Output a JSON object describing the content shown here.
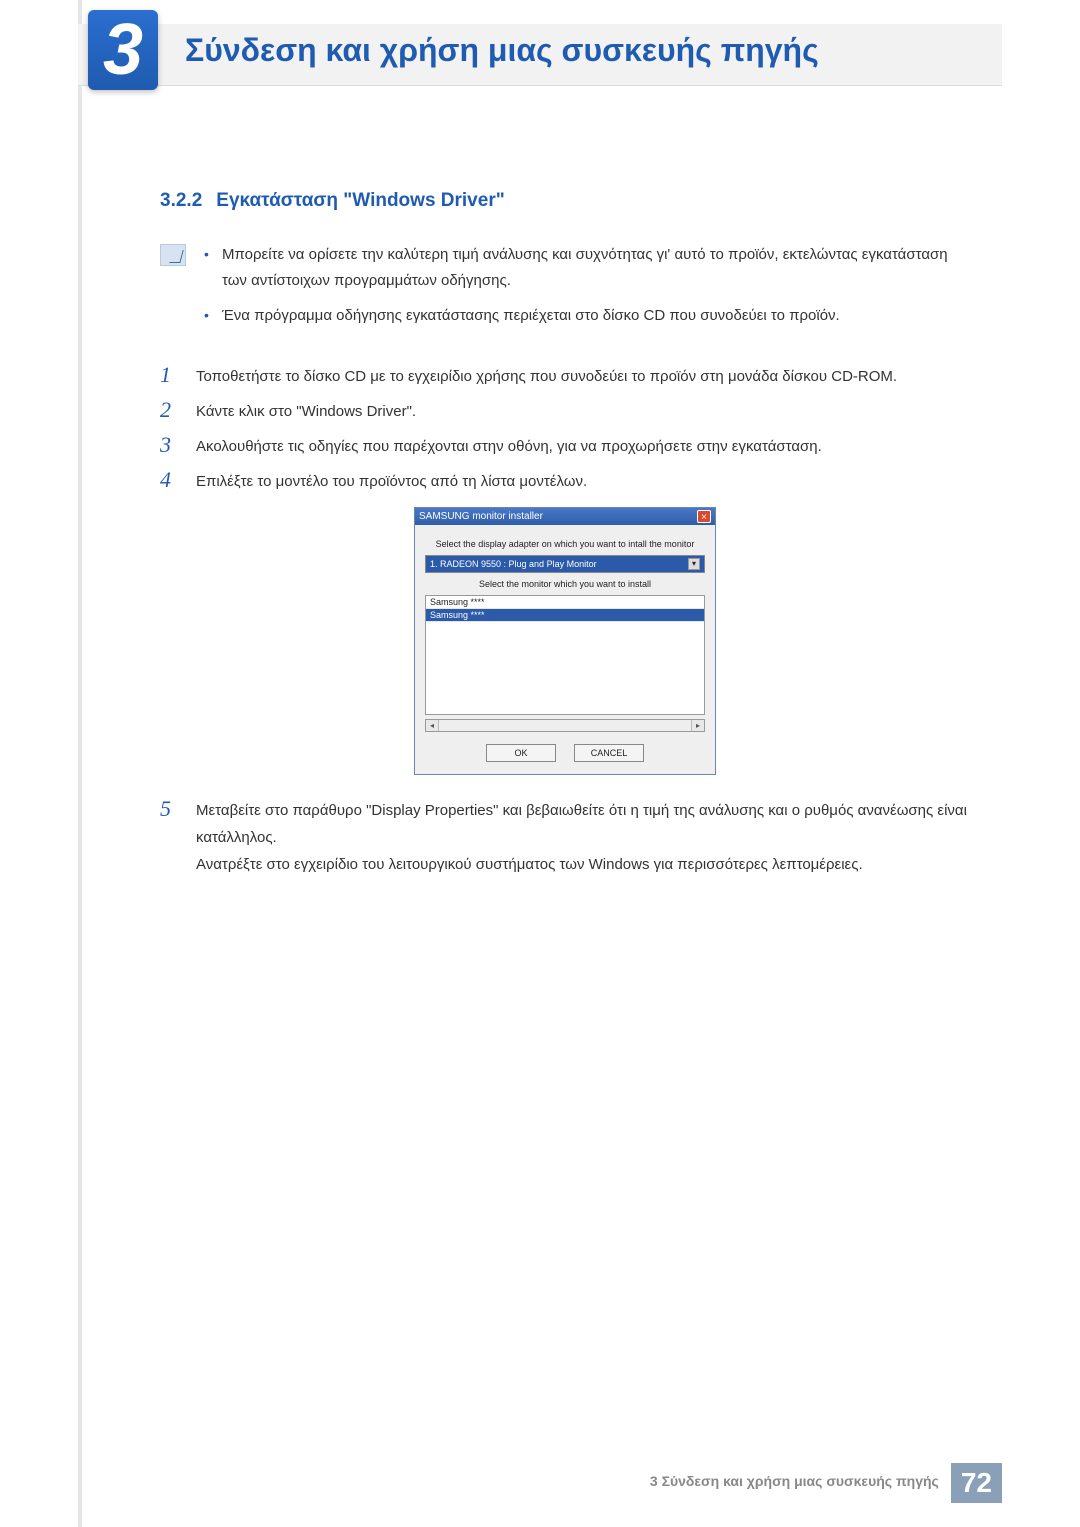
{
  "header": {
    "chapter_number": "3",
    "chapter_title": "Σύνδεση και χρήση μιας συσκευής πηγής"
  },
  "subsection": {
    "number": "3.2.2",
    "title": "Εγκατάσταση \"Windows Driver\""
  },
  "notes": [
    "Μπορείτε να ορίσετε την καλύτερη τιμή ανάλυσης και συχνότητας γι' αυτό το προϊόν, εκτελώντας εγκατάσταση των αντίστοιχων προγραμμάτων οδήγησης.",
    "Ένα πρόγραμμα οδήγησης εγκατάστασης περιέχεται στο δίσκο CD που συνοδεύει το προϊόν."
  ],
  "steps": [
    {
      "n": "1",
      "text": "Τοποθετήστε το δίσκο CD με το εγχειρίδιο χρήσης που συνοδεύει το προϊόν στη μονάδα δίσκου CD-ROM."
    },
    {
      "n": "2",
      "text": "Κάντε κλικ στο \"Windows Driver\"."
    },
    {
      "n": "3",
      "text": "Ακολουθήστε τις οδηγίες που παρέχονται στην οθόνη, για να προχωρήσετε στην εγκατάσταση."
    },
    {
      "n": "4",
      "text": "Επιλέξτε το μοντέλο του προϊόντος από τη λίστα μοντέλων."
    },
    {
      "n": "5",
      "text": "Μεταβείτε στο παράθυρο \"Display Properties\" και βεβαιωθείτε ότι η τιμή της ανάλυσης και ο ρυθμός ανανέωσης είναι κατάλληλος."
    },
    {
      "text_extra": "Ανατρέξτε στο εγχειρίδιο του λειτουργικού συστήματος των Windows για περισσότερες λεπτομέρειες."
    }
  ],
  "installer": {
    "title": "SAMSUNG monitor installer",
    "label_adapter": "Select the display adapter on which you want to intall the monitor",
    "adapter_value": "1. RADEON 9550 : Plug and Play Monitor",
    "label_monitor": "Select the monitor which you want to install",
    "list_items": [
      "Samsung ****",
      "Samsung ****"
    ],
    "ok": "OK",
    "cancel": "CANCEL"
  },
  "footer": {
    "text": "3 Σύνδεση και χρήση μιας συσκευής πηγής",
    "page": "72"
  }
}
